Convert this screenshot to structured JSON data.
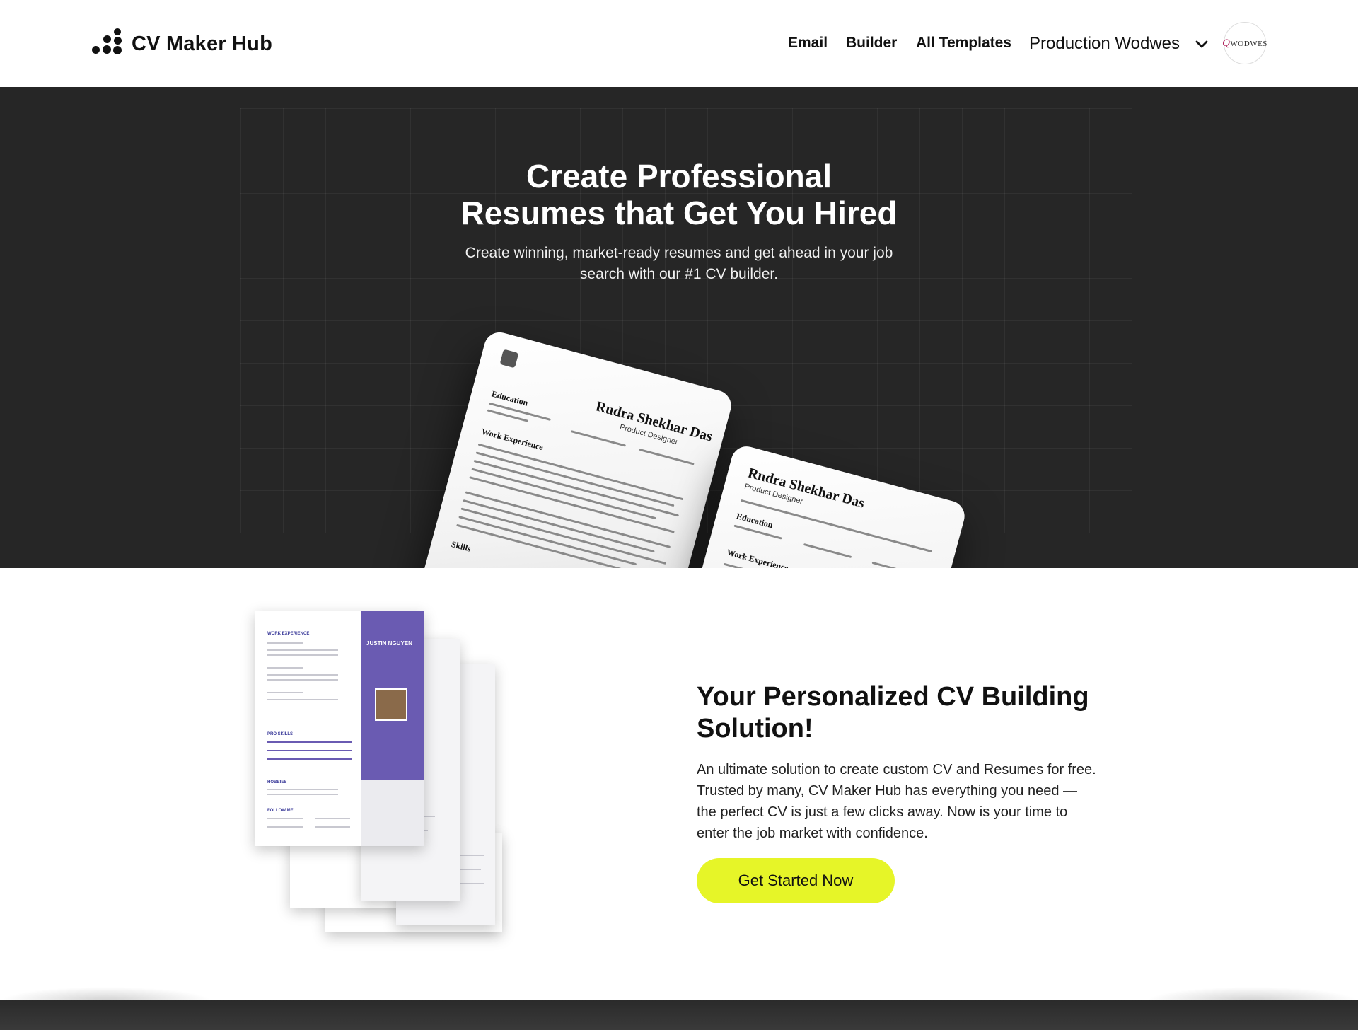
{
  "header": {
    "brand": "CV Maker Hub",
    "nav": [
      {
        "label": "Email"
      },
      {
        "label": "Builder"
      },
      {
        "label": "All Templates"
      }
    ],
    "user_name": "Production Wodwes",
    "avatar_text": "WODWES"
  },
  "hero": {
    "title_line1": "Create Professional",
    "title_line2": "Resumes that Get You Hired",
    "subtitle": "Create winning, market-ready resumes and get ahead in your job search with our #1 CV builder.",
    "resume_front": {
      "name": "Rudra Shekhar Das",
      "role": "Product Designer",
      "sections": [
        "Education",
        "Work Experience",
        "Skills"
      ]
    },
    "resume_back": {
      "name": "Rudra Shekhar Das",
      "role": "Product Designer",
      "sections": [
        "Education",
        "Work Experience"
      ]
    }
  },
  "feature": {
    "template_name": "JUSTIN NGUYEN",
    "title": "Your Personalized CV Building Solution!",
    "text": "An ultimate solution to create custom CV and Resumes for free. Trusted by many, CV Maker Hub has everything you need — the perfect CV is just a few clicks away. Now is your time to enter the job market with confidence.",
    "cta_label": "Get Started Now"
  },
  "colors": {
    "hero_bg": "#262626",
    "cta_bg": "#e6f528",
    "template_purple": "#6a5bb2",
    "template_navy": "#1b2a5a"
  }
}
